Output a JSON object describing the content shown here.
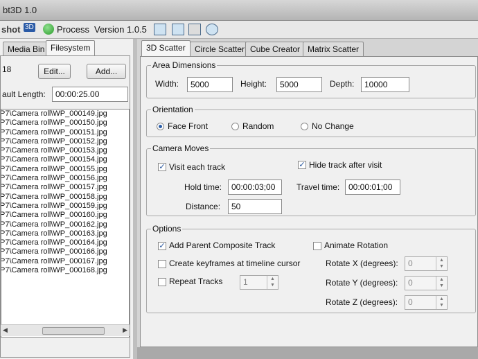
{
  "window": {
    "title": "bt3D 1.0"
  },
  "toolbar": {
    "brand": "shot",
    "logo": "3D",
    "process_label": "Process",
    "version": "Version 1.0.5"
  },
  "left": {
    "tabs": [
      "Media Bin",
      "Filesystem"
    ],
    "active_tab": "Filesystem",
    "count": "18",
    "edit_label": "Edit...",
    "add_label": "Add...",
    "default_length_label": "ault Length:",
    "default_length_value": "00:00:25.00",
    "files": [
      "P7\\Camera roll\\WP_000149.jpg",
      "P7\\Camera roll\\WP_000150.jpg",
      "P7\\Camera roll\\WP_000151.jpg",
      "P7\\Camera roll\\WP_000152.jpg",
      "P7\\Camera roll\\WP_000153.jpg",
      "P7\\Camera roll\\WP_000154.jpg",
      "P7\\Camera roll\\WP_000155.jpg",
      "P7\\Camera roll\\WP_000156.jpg",
      "P7\\Camera roll\\WP_000157.jpg",
      "P7\\Camera roll\\WP_000158.jpg",
      "P7\\Camera roll\\WP_000159.jpg",
      "P7\\Camera roll\\WP_000160.jpg",
      "P7\\Camera roll\\WP_000162.jpg",
      "P7\\Camera roll\\WP_000163.jpg",
      "P7\\Camera roll\\WP_000164.jpg",
      "P7\\Camera roll\\WP_000166.jpg",
      "P7\\Camera roll\\WP_000167.jpg",
      "P7\\Camera roll\\WP_000168.jpg"
    ]
  },
  "right": {
    "tabs": [
      "3D Scatter",
      "Circle Scatter",
      "Cube Creator",
      "Matrix Scatter"
    ],
    "active_tab": "3D Scatter",
    "area": {
      "legend": "Area Dimensions",
      "width_label": "Width:",
      "width_value": "5000",
      "height_label": "Height:",
      "height_value": "5000",
      "depth_label": "Depth:",
      "depth_value": "10000"
    },
    "orientation": {
      "legend": "Orientation",
      "options": [
        "Face Front",
        "Random",
        "No Change"
      ],
      "selected": "Face Front"
    },
    "camera": {
      "legend": "Camera Moves",
      "visit_label": "Visit each track",
      "visit_checked": true,
      "hide_label": "Hide track after visit",
      "hide_checked": true,
      "hold_label": "Hold time:",
      "hold_value": "00:00:03;00",
      "travel_label": "Travel time:",
      "travel_value": "00:00:01;00",
      "distance_label": "Distance:",
      "distance_value": "50"
    },
    "options": {
      "legend": "Options",
      "parent_label": "Add Parent Composite Track",
      "parent_checked": true,
      "keyframes_label": "Create keyframes at timeline cursor",
      "keyframes_checked": false,
      "repeat_label": "Repeat Tracks",
      "repeat_checked": false,
      "repeat_value": "1",
      "animate_label": "Animate Rotation",
      "animate_checked": false,
      "rot_x_label": "Rotate X (degrees):",
      "rot_x_value": "0",
      "rot_y_label": "Rotate Y (degrees):",
      "rot_y_value": "0",
      "rot_z_label": "Rotate Z (degrees):",
      "rot_z_value": "0"
    }
  }
}
